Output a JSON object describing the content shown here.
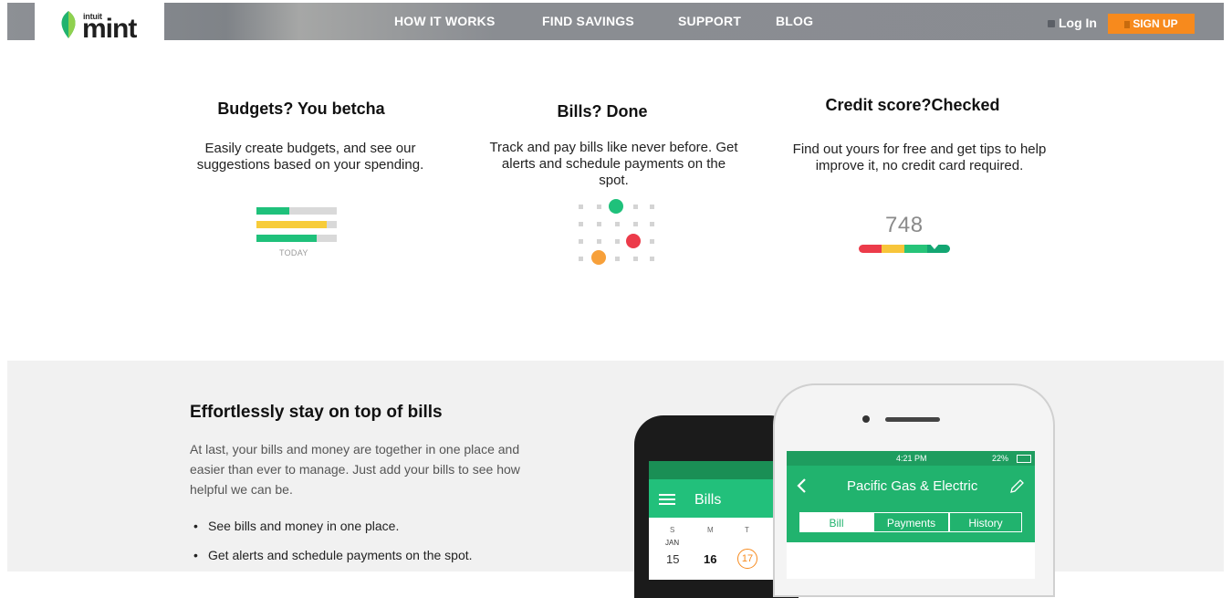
{
  "header": {
    "logo": {
      "brand": "intuit",
      "word": "mint"
    },
    "nav": [
      "HOW IT WORKS",
      "FIND SAVINGS",
      "SUPPORT",
      "BLOG"
    ],
    "login_label": "Log In",
    "signup_label": "SIGN UP"
  },
  "features": [
    {
      "title": "Budgets? You betcha",
      "desc": "Easily create budgets, and see our suggestions based on your spending."
    },
    {
      "title": "Bills? Done",
      "desc": "Track and pay bills like never before. Get alerts and schedule payments on the spot."
    },
    {
      "title": "Credit score?Checked",
      "desc": "Find out yours for free and get tips to help improve it, no credit card required."
    }
  ],
  "budget_graphic": {
    "label": "TODAY",
    "bars": [
      0.41,
      0.88,
      0.75
    ],
    "colors": [
      "#1fc17b",
      "#f7cc3a",
      "#1fc17b"
    ]
  },
  "credit_graphic": {
    "score": "748",
    "colors": [
      "#ec3b4a",
      "#f7c53a",
      "#27c479",
      "#13a672"
    ]
  },
  "bills": {
    "title": "Effortlessly stay on top of bills",
    "desc": "At last, your bills and money are together in one place and easier than ever to manage. Just add your bills to see how helpful we can be.",
    "bullets": [
      "See bills and money in one place.",
      "Get alerts and schedule payments on the spot."
    ]
  },
  "phone_back": {
    "title": "Bills",
    "days": [
      "S",
      "M",
      "T"
    ],
    "month": "JAN",
    "dates": [
      "15",
      "16",
      "17"
    ]
  },
  "phone_front": {
    "time": "4:21 PM",
    "battery": "22%",
    "title": "Pacific Gas & Electric",
    "tabs": [
      "Bill",
      "Payments",
      "History"
    ]
  },
  "colors": {
    "accent": "#f78a1d",
    "green": "#21b36e"
  }
}
